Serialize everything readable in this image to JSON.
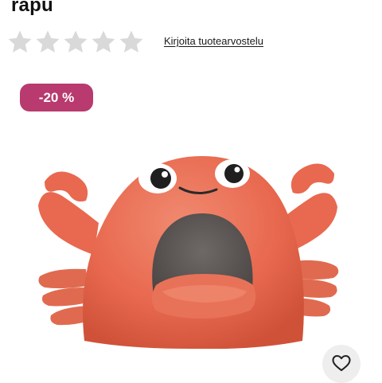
{
  "product": {
    "title": "rapu",
    "rating": {
      "stars_filled": 0,
      "stars_total": 5,
      "star_color": "#d9d9d9",
      "write_review_label": "Kirjoita tuotearvostelu"
    },
    "discount_badge": {
      "label": "-20 %",
      "color": "#b83a6e"
    },
    "image": {
      "icon": "crab-cat-bed-image"
    },
    "wishlist": {
      "icon": "heart-outline-icon"
    }
  }
}
